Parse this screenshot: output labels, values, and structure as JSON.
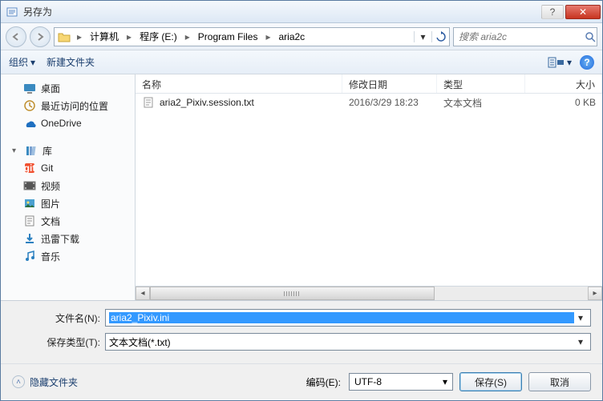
{
  "title": "另存为",
  "breadcrumb": [
    "计算机",
    "程序 (E:)",
    "Program Files",
    "aria2c"
  ],
  "search_placeholder": "搜索 aria2c",
  "toolbar": {
    "organize": "组织",
    "newfolder": "新建文件夹"
  },
  "sidebar": {
    "desktop": "桌面",
    "recent": "最近访问的位置",
    "onedrive": "OneDrive",
    "libraries": "库",
    "git": "Git",
    "videos": "视频",
    "pictures": "图片",
    "documents": "文档",
    "thunder": "迅雷下载",
    "music": "音乐"
  },
  "columns": {
    "name": "名称",
    "modified": "修改日期",
    "type": "类型",
    "size": "大小"
  },
  "files": [
    {
      "name": "aria2_Pixiv.session.txt",
      "modified": "2016/3/29 18:23",
      "type": "文本文档",
      "size": "0 KB"
    }
  ],
  "form": {
    "filename_label": "文件名(N):",
    "filename_value": "aria2_Pixiv.ini",
    "filetype_label": "保存类型(T):",
    "filetype_value": "文本文档(*.txt)"
  },
  "footer": {
    "hide_folders": "隐藏文件夹",
    "encoding_label": "编码(E):",
    "encoding_value": "UTF-8",
    "save": "保存(S)",
    "cancel": "取消"
  }
}
